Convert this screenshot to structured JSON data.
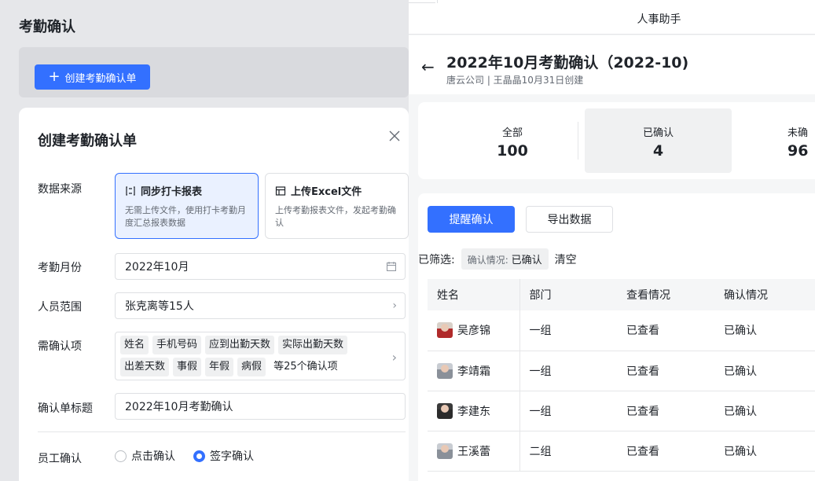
{
  "left": {
    "page_title": "考勤确认",
    "create_button": "创建考勤确认单",
    "modal": {
      "title": "创建考勤确认单",
      "data_source_label": "数据来源",
      "sources": [
        {
          "title": "同步打卡报表",
          "desc": "无需上传文件，使用打卡考勤月度汇总报表数据",
          "icon": "sync-icon",
          "selected": true
        },
        {
          "title": "上传Excel文件",
          "desc": "上传考勤报表文件，发起考勤确认",
          "icon": "table-icon",
          "selected": false
        }
      ],
      "month_label": "考勤月份",
      "month_value": "2022年10月",
      "scope_label": "人员范围",
      "scope_value": "张克离等15人",
      "items_label": "需确认项",
      "items_row1": [
        "姓名",
        "手机号码",
        "应到出勤天数",
        "实际出勤天数"
      ],
      "items_row2": [
        "出差天数",
        "事假",
        "年假",
        "病假"
      ],
      "items_more": "等25个确认项",
      "title_label": "确认单标题",
      "title_value": "2022年10月考勤确认",
      "employee_confirm_label": "员工确认",
      "radio_click": "点击确认",
      "radio_sign": "签字确认"
    }
  },
  "right": {
    "app_title": "人事助手",
    "record_title": "2022年10月考勤确认（2022-10)",
    "record_sub": "唐云公司 |   王晶晶10月31日创建",
    "stats": [
      {
        "label": "全部",
        "value": "100"
      },
      {
        "label": "已确认",
        "value": "4"
      },
      {
        "label": "未确",
        "value": "96"
      }
    ],
    "btn_remind": "提醒确认",
    "btn_export": "导出数据",
    "filter_label": "已筛选:",
    "filter_key": "确认情况:",
    "filter_val": "已确认",
    "filter_clear": "清空",
    "columns": [
      "姓名",
      "部门",
      "查看情况",
      "确认情况"
    ],
    "rows": [
      {
        "name": "吴彦锦",
        "dept": "一组",
        "view": "已查看",
        "confirm": "已确认"
      },
      {
        "name": "李靖霜",
        "dept": "一组",
        "view": "已查看",
        "confirm": "已确认"
      },
      {
        "name": "李建东",
        "dept": "一组",
        "view": "已查看",
        "confirm": "已确认"
      },
      {
        "name": "王溪蕾",
        "dept": "二组",
        "view": "已查看",
        "confirm": "已确认"
      }
    ],
    "colors": {
      "accent": "#3370ff"
    }
  }
}
